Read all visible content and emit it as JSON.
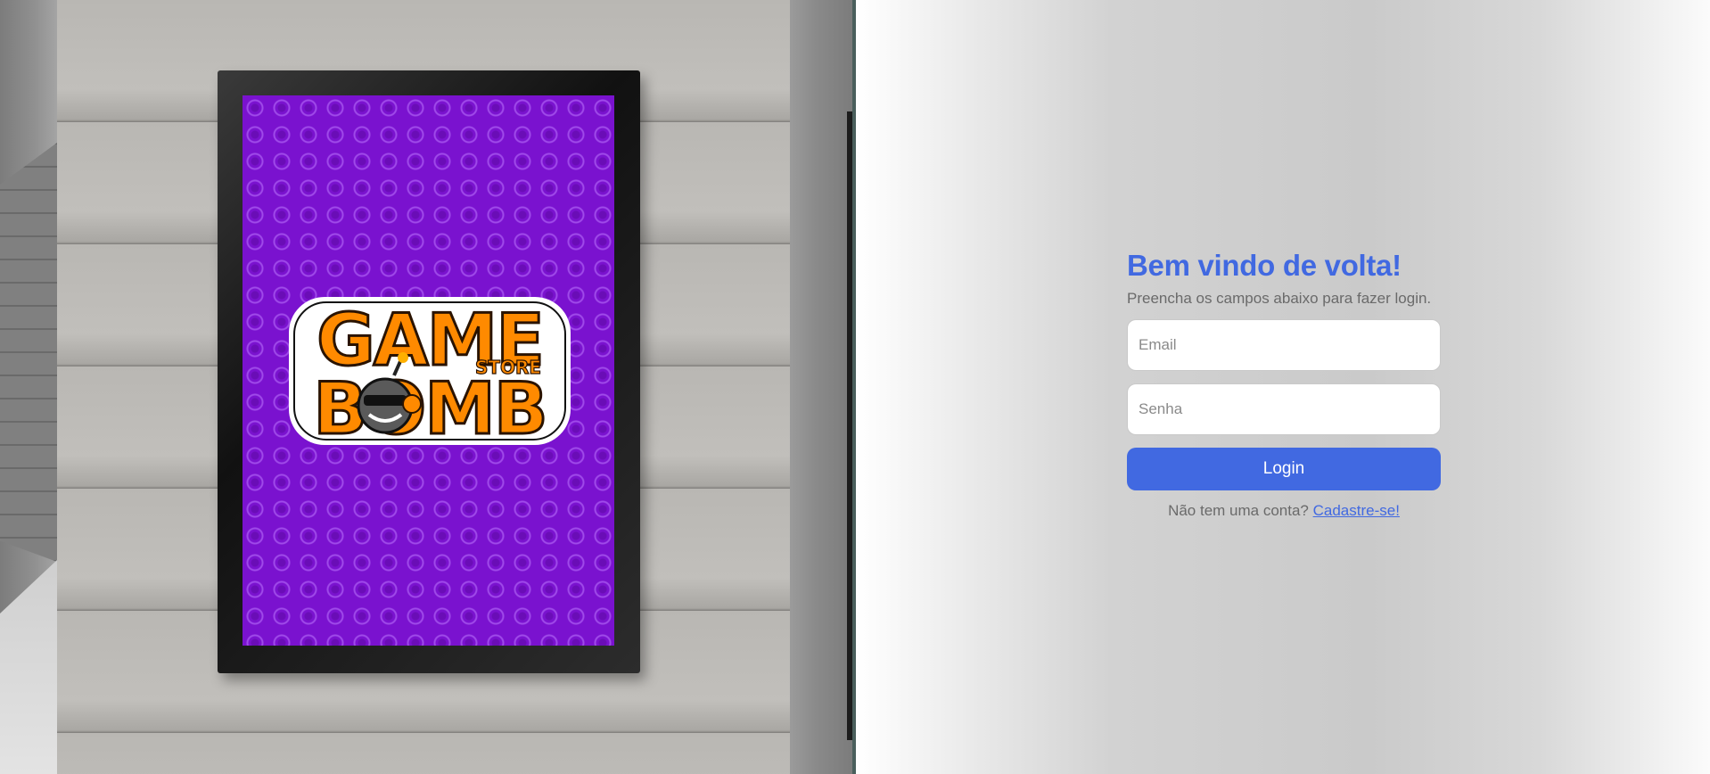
{
  "hero": {
    "image_label": "GAME BOMB STORE poster",
    "logo": {
      "line1": "GAME",
      "line2": "BOMB",
      "tag": "STORE",
      "colors": {
        "fill": "#ff8a00",
        "outline": "#3a1a00",
        "poster_bg": "#7a12cf"
      }
    }
  },
  "login": {
    "title": "Bem vindo de volta!",
    "subtitle": "Preencha os campos abaixo para fazer login.",
    "email_placeholder": "Email",
    "email_value": "",
    "password_placeholder": "Senha",
    "password_value": "",
    "submit_label": "Login",
    "signup_prompt": "Não tem uma conta?",
    "signup_link": "Cadastre-se!",
    "colors": {
      "accent": "#4169e1",
      "muted_text": "#6a6a6a"
    }
  }
}
